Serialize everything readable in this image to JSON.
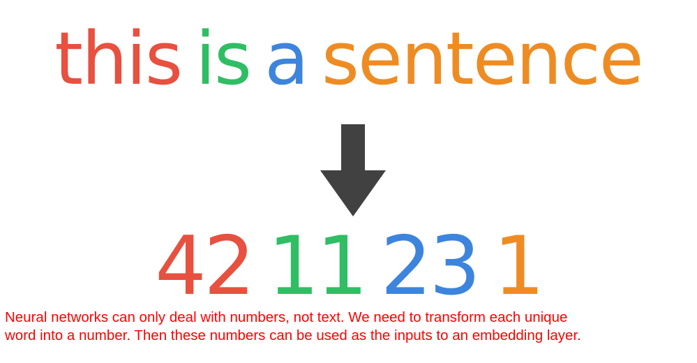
{
  "sentence": {
    "words": [
      {
        "text": "this",
        "color": "#e8503f"
      },
      {
        "text": "is",
        "color": "#2fbe63"
      },
      {
        "text": "a",
        "color": "#3d84dd"
      },
      {
        "text": "sentence",
        "color": "#ee8c23"
      }
    ]
  },
  "arrow": {
    "icon": "down-arrow-icon",
    "color": "#414141"
  },
  "numbers": [
    {
      "text": "42",
      "color": "#e8503f"
    },
    {
      "text": "11",
      "color": "#2fbe63"
    },
    {
      "text": "23",
      "color": "#3d84dd"
    },
    {
      "text": "1",
      "color": "#ee8c23"
    }
  ],
  "caption": {
    "line1": "Neural networks can only deal with numbers, not text. We need to transform each unique",
    "line2": "word into a number. Then these numbers can be used as the inputs to an embedding layer.",
    "color": "#ff0000"
  }
}
